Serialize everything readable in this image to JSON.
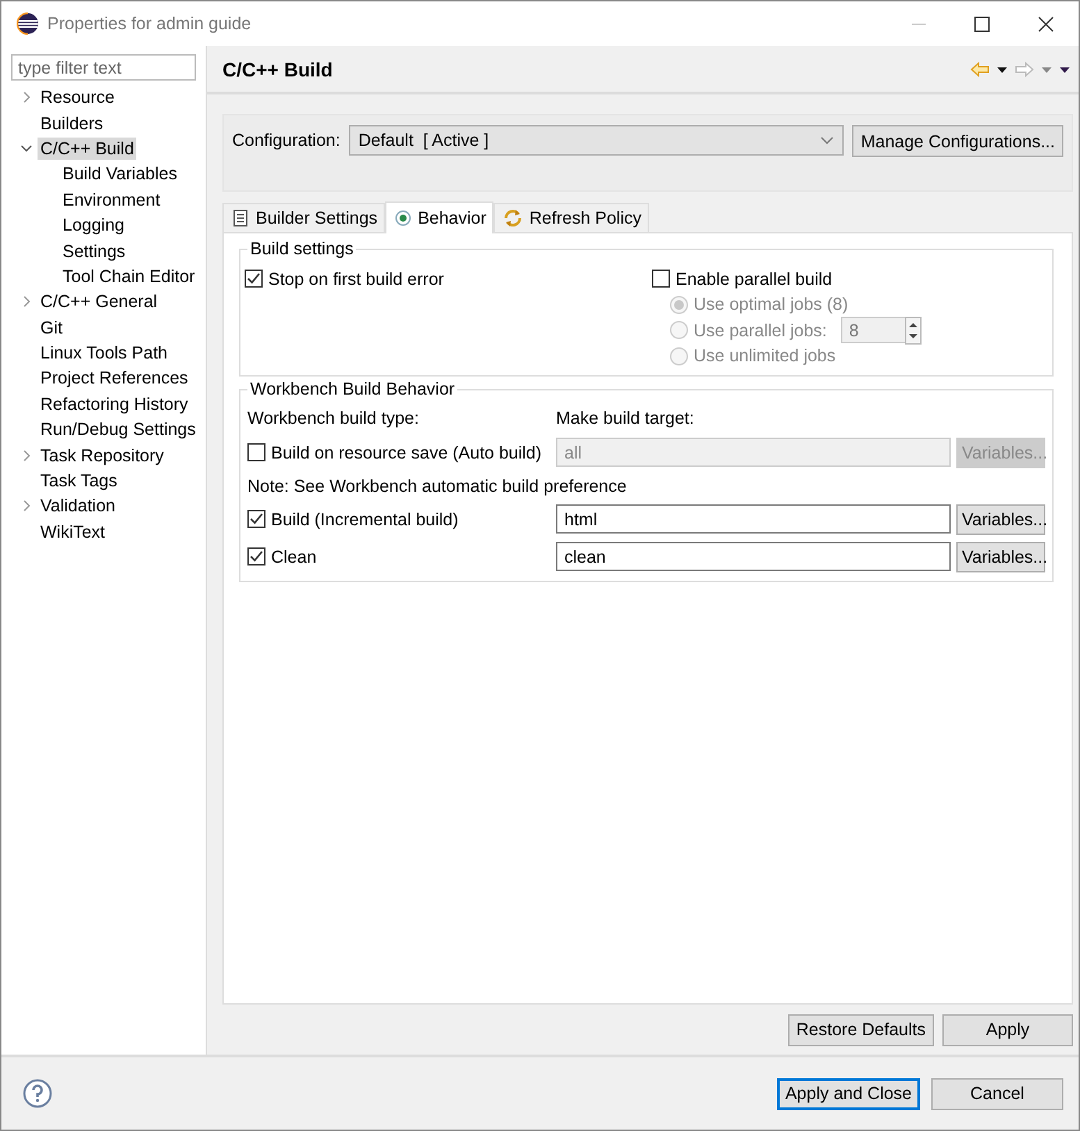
{
  "window": {
    "title": "Properties for admin guide"
  },
  "sidebar": {
    "filter": {
      "placeholder": "type filter text"
    },
    "items": [
      {
        "label": "Resource",
        "expanded": false,
        "selected": false
      },
      {
        "label": "Builders",
        "selected": false
      },
      {
        "label": "C/C++ Build",
        "expanded": true,
        "selected": true,
        "children": [
          {
            "label": "Build Variables",
            "selected": false
          },
          {
            "label": "Environment",
            "selected": false
          },
          {
            "label": "Logging",
            "selected": false
          },
          {
            "label": "Settings",
            "selected": false
          },
          {
            "label": "Tool Chain Editor",
            "selected": false
          }
        ]
      },
      {
        "label": "C/C++ General",
        "expanded": false,
        "selected": false
      },
      {
        "label": "Git",
        "selected": false
      },
      {
        "label": "Linux Tools Path",
        "selected": false
      },
      {
        "label": "Project References",
        "selected": false
      },
      {
        "label": "Refactoring History",
        "selected": false
      },
      {
        "label": "Run/Debug Settings",
        "selected": false
      },
      {
        "label": "Task Repository",
        "expanded": false,
        "selected": false
      },
      {
        "label": "Task Tags",
        "selected": false
      },
      {
        "label": "Validation",
        "expanded": false,
        "selected": false
      },
      {
        "label": "WikiText",
        "selected": false
      }
    ]
  },
  "page": {
    "title": "C/C++ Build"
  },
  "configuration": {
    "label": "Configuration:",
    "value": "Default  [ Active ]",
    "manage_button": "Manage Configurations..."
  },
  "tabs": [
    {
      "label": "Builder Settings",
      "selected": false
    },
    {
      "label": "Behavior",
      "selected": true
    },
    {
      "label": "Refresh Policy",
      "selected": false
    }
  ],
  "build_settings": {
    "title": "Build settings",
    "stop_on_error": {
      "label": "Stop on first build error",
      "checked": true
    },
    "parallel": {
      "label": "Enable parallel build",
      "checked": false
    },
    "job_options": [
      {
        "label": "Use optimal jobs (8)",
        "selected": true,
        "disabled": true
      },
      {
        "label": "Use parallel jobs:",
        "selected": false,
        "disabled": true
      },
      {
        "label": "Use unlimited jobs",
        "selected": false,
        "disabled": true
      }
    ],
    "parallel_jobs": "8"
  },
  "workbench": {
    "title": "Workbench Build Behavior",
    "type_label": "Workbench build type:",
    "target_label": "Make build target:",
    "note": "Note: See Workbench automatic build preference",
    "rows": [
      {
        "label": "Build on resource save (Auto build)",
        "checked": false,
        "target": "all",
        "disabled": true,
        "variables": "Variables..."
      },
      {
        "label": "Build (Incremental build)",
        "checked": true,
        "target": "html",
        "disabled": false,
        "variables": "Variables..."
      },
      {
        "label": "Clean",
        "checked": true,
        "target": "clean",
        "disabled": false,
        "variables": "Variables..."
      }
    ]
  },
  "page_buttons": [
    "Restore Defaults",
    "Apply"
  ],
  "dialog_buttons": [
    {
      "label": "Apply and Close",
      "default": true
    },
    {
      "label": "Cancel",
      "default": false
    }
  ]
}
